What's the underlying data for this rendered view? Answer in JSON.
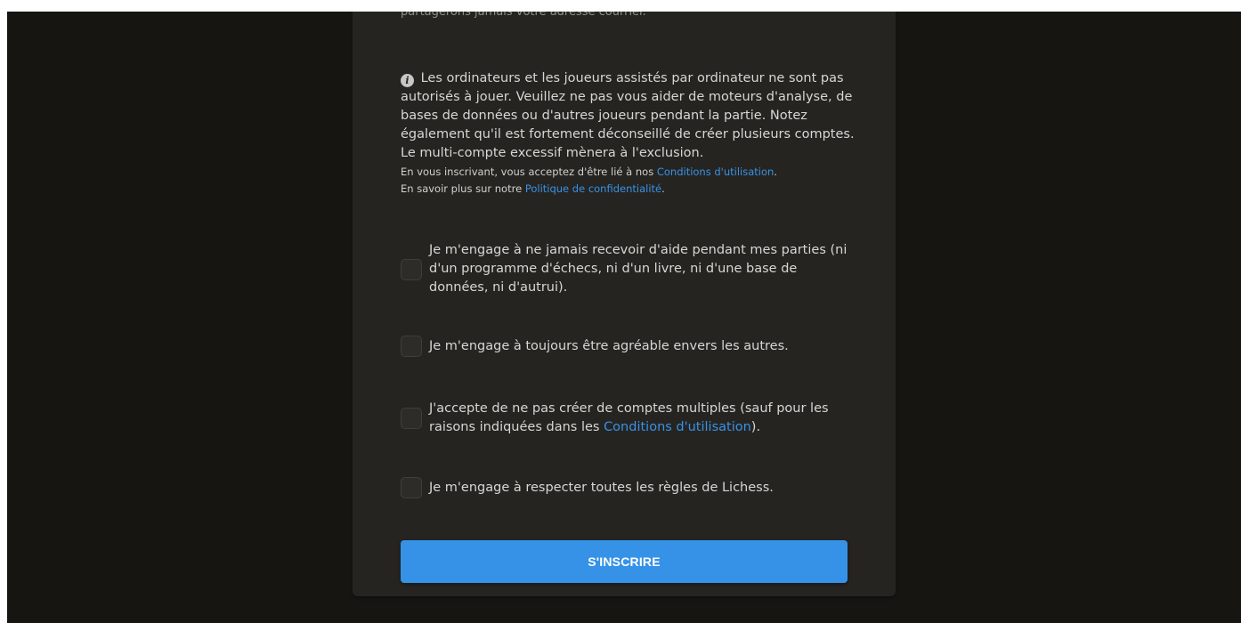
{
  "top_cutoff_text": "partagerons jamais votre adresse courriel.",
  "info": {
    "icon": "info-icon",
    "main_text": "Les ordinateurs et les joueurs assistés par ordinateur ne sont pas autorisés à jouer. Veuillez ne pas vous aider de moteurs d'analyse, de bases de données ou d'autres joueurs pendant la partie. Notez également qu'il est fortement déconseillé de créer plusieurs comptes. Le multi-compte excessif mènera à l'exclusion.",
    "tos_prefix": "En vous inscrivant, vous acceptez d'être lié à nos ",
    "tos_link": "Conditions d'utilisation",
    "tos_suffix": ".",
    "privacy_prefix": "En savoir plus sur notre ",
    "privacy_link": "Politique de confidentialité",
    "privacy_suffix": "."
  },
  "agreements": {
    "assistance": "Je m'engage à ne jamais recevoir d'aide pendant mes parties (ni d'un programme d'échecs, ni d'un livre, ni d'une base de données, ni d'autrui).",
    "nice": "Je m'engage à toujours être agréable envers les autres.",
    "multi_prefix": "J'accepte de ne pas créer de comptes multiples (sauf pour les raisons indiquées dans les ",
    "multi_link": "Conditions d'utilisation",
    "multi_suffix": ").",
    "policy": "Je m'engage à respecter toutes les règles de Lichess."
  },
  "submit_label": "S'INSCRIRE",
  "colors": {
    "page_background": "#161512",
    "card_background": "#262421",
    "accent": "#3692e7",
    "text": "#d7d6d4"
  }
}
